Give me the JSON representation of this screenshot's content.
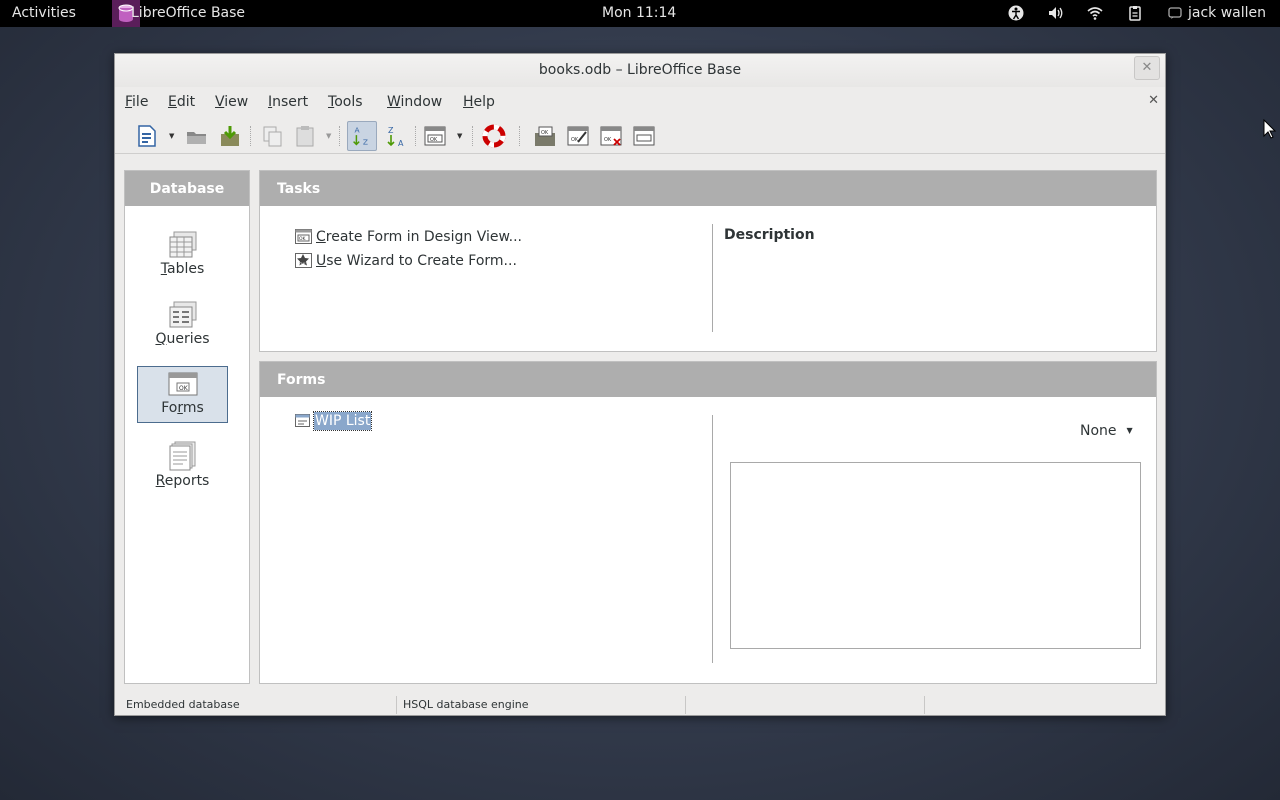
{
  "topbar": {
    "activities": "Activities",
    "app_name": "LibreOffice Base",
    "clock": "Mon 11:14",
    "user": "jack wallen",
    "tray_icons": [
      "accessibility-icon",
      "volume-icon",
      "wifi-icon",
      "clipboard-icon"
    ]
  },
  "window": {
    "title": "books.odb – LibreOffice Base",
    "close_glyph": "✕"
  },
  "menu": [
    {
      "key": "F",
      "rest": "ile"
    },
    {
      "key": "E",
      "rest": "dit"
    },
    {
      "key": "V",
      "rest": "iew"
    },
    {
      "key": "I",
      "rest": "nsert"
    },
    {
      "key": "T",
      "rest": "ools"
    },
    {
      "key": "W",
      "rest": "indow"
    },
    {
      "key": "H",
      "rest": "elp"
    }
  ],
  "toolbar": {
    "icons": [
      "new-document-icon",
      "open-icon",
      "save-icon",
      "copy-icon",
      "paste-icon",
      "sort-ascending-icon",
      "sort-descending-icon",
      "form-icon",
      "help-icon",
      "open-db-object-icon",
      "edit-icon",
      "delete-icon",
      "rename-icon"
    ]
  },
  "database_panel": {
    "title": "Database",
    "items": [
      {
        "key": "",
        "label": "Tables",
        "underline": "T",
        "rest": "ables",
        "icon": "table-icon",
        "selected": false
      },
      {
        "key": "",
        "label": "Queries",
        "underline": "Q",
        "rest": "ueries",
        "icon": "query-icon",
        "selected": false
      },
      {
        "key": "",
        "label": "Forms",
        "underline": "",
        "pre": "Fo",
        "mid": "r",
        "rest": "ms",
        "icon": "form-icon",
        "selected": true
      },
      {
        "key": "",
        "label": "Reports",
        "underline": "R",
        "rest": "eports",
        "icon": "report-icon",
        "selected": false
      }
    ]
  },
  "tasks_panel": {
    "title": "Tasks",
    "tasks": [
      {
        "key": "C",
        "rest": "reate Form in Design View..."
      },
      {
        "key": "U",
        "rest": "se Wizard to Create Form..."
      }
    ],
    "description_title": "Description"
  },
  "forms_panel": {
    "title": "Forms",
    "items": [
      "WIP List"
    ],
    "preview_mode": "None"
  },
  "statusbar": {
    "left": "Embedded database",
    "middle": "HSQL database engine"
  }
}
